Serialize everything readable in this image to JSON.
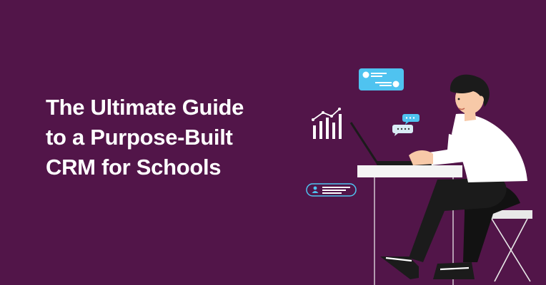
{
  "headline": {
    "line1": "The Ultimate Guide",
    "line2": "to a Purpose-Built",
    "line3": "CRM for Schools"
  },
  "colors": {
    "background": "#521549",
    "text": "#ffffff",
    "chat_bubble": "#4fc3f0",
    "desk": "#f4f4f4",
    "person_shirt": "#ffffff",
    "person_pants": "#1b1b1b",
    "person_skin": "#f7c9a8",
    "person_hair": "#1b1b1b"
  },
  "icons": {
    "chart": "bar-chart-trend-icon",
    "contact_chat": "contact-chat-bubble-icon",
    "typing_bubbles": "typing-chat-bubbles-icon",
    "user_card": "user-card-icon"
  }
}
